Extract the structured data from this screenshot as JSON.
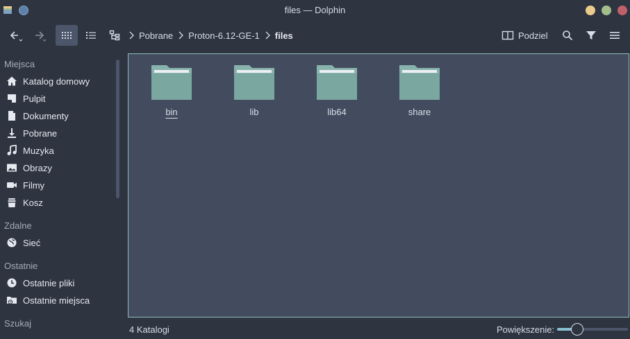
{
  "window": {
    "title": "files — Dolphin",
    "accent_color": "#88c0d0"
  },
  "toolbar": {
    "back_icon": "arrow-left-icon",
    "forward_icon": "arrow-right-icon",
    "view_icons_icon": "grid-view-icon",
    "view_details_icon": "list-view-icon",
    "view_tree_icon": "tree-view-icon",
    "split_label": "Podziel",
    "search_icon": "search-icon",
    "filter_icon": "filter-icon",
    "menu_icon": "hamburger-menu-icon"
  },
  "breadcrumb": {
    "items": [
      "Pobrane",
      "Proton-6.12-GE-1",
      "files"
    ]
  },
  "sidebar": {
    "sections": [
      {
        "label": "Miejsca",
        "items": [
          {
            "label": "Katalog domowy",
            "icon": "home-icon"
          },
          {
            "label": "Pulpit",
            "icon": "desktop-icon"
          },
          {
            "label": "Dokumenty",
            "icon": "document-icon"
          },
          {
            "label": "Pobrane",
            "icon": "download-icon"
          },
          {
            "label": "Muzyka",
            "icon": "music-icon"
          },
          {
            "label": "Obrazy",
            "icon": "image-icon"
          },
          {
            "label": "Filmy",
            "icon": "video-icon"
          },
          {
            "label": "Kosz",
            "icon": "trash-icon"
          }
        ]
      },
      {
        "label": "Zdalne",
        "items": [
          {
            "label": "Sieć",
            "icon": "network-icon"
          }
        ]
      },
      {
        "label": "Ostatnie",
        "items": [
          {
            "label": "Ostatnie pliki",
            "icon": "recent-files-icon"
          },
          {
            "label": "Ostatnie miejsca",
            "icon": "recent-places-icon"
          }
        ]
      },
      {
        "label": "Szukaj",
        "items": []
      }
    ]
  },
  "files": [
    {
      "name": "bin",
      "type": "folder"
    },
    {
      "name": "lib",
      "type": "folder"
    },
    {
      "name": "lib64",
      "type": "folder"
    },
    {
      "name": "share",
      "type": "folder"
    }
  ],
  "statusbar": {
    "summary": "4 Katalogi",
    "zoom_label": "Powiększenie:",
    "zoom_level": 0.28
  }
}
